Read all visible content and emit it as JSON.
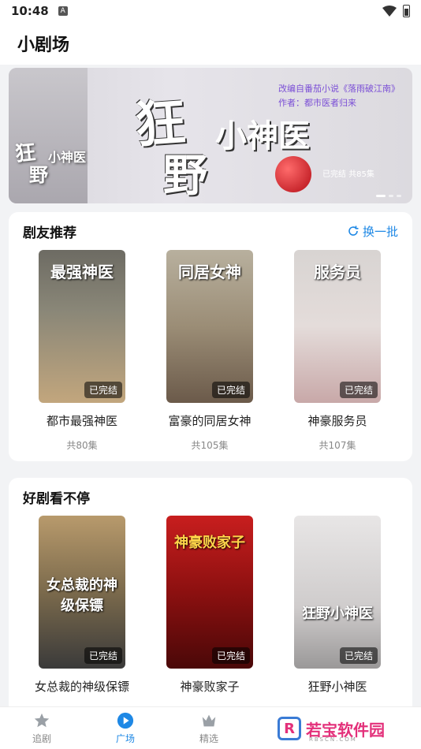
{
  "status_bar": {
    "time": "10:48",
    "notification_icon": "A"
  },
  "app_bar": {
    "title": "小剧场"
  },
  "banner": {
    "title_big_1": "狂",
    "title_big_2": "野",
    "title_small": "小神医",
    "promo_line_1": "改编自番茄小说《落雨破江南》",
    "promo_line_2": "作者：都市医者归来",
    "status": "已完结 共85集",
    "thumb_text_1": "狂",
    "thumb_text_2": "小神医",
    "thumb_text_3": "野"
  },
  "section_recommend": {
    "title": "剧友推荐",
    "refresh_label": "换一批",
    "items": [
      {
        "name": "都市最强神医",
        "count": "共80集",
        "badge": "已完结",
        "poster_text": "最强神医"
      },
      {
        "name": "富豪的同居女神",
        "count": "共105集",
        "badge": "已完结",
        "poster_text": "同居女神"
      },
      {
        "name": "神豪服务员",
        "count": "共107集",
        "badge": "已完结",
        "poster_text": "服务员"
      }
    ]
  },
  "section_nonstop": {
    "title": "好剧看不停",
    "items": [
      {
        "name": "女总裁的神级保镖",
        "badge": "已完结",
        "poster_text": "女总裁的神级保镖"
      },
      {
        "name": "神豪败家子",
        "badge": "已完结",
        "poster_text": "神豪败家子"
      },
      {
        "name": "狂野小神医",
        "badge": "已完结",
        "poster_text": "狂野小神医"
      }
    ]
  },
  "bottom_nav": {
    "items": [
      {
        "label": "追剧",
        "icon": "star-icon"
      },
      {
        "label": "广场",
        "icon": "play-circle-icon"
      },
      {
        "label": "精选",
        "icon": "crown-icon"
      }
    ]
  },
  "watermark": {
    "logo": "R",
    "text": "若宝软件园",
    "sub": "RBSCN.COM"
  },
  "colors": {
    "accent": "#1e88e5",
    "background": "#f2f3f5"
  }
}
